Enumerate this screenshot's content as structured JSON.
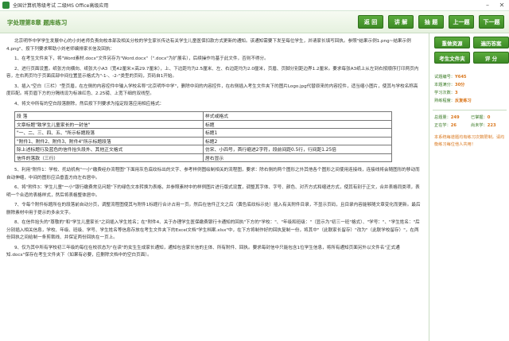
{
  "window": {
    "title": "全国计算机等级考试 二级MS Office高级应用",
    "minimize_icon": "minimize-icon",
    "close_icon": "close-icon"
  },
  "header": {
    "breadcrumb": "字处理第8章 题库练习",
    "nav_buttons": [
      "返 回",
      "讲 解",
      "抽 题",
      "上一题",
      "下一题"
    ]
  },
  "question": {
    "paragraphs_before_table": [
      "北京明华中学学生发展中心的小刘老师负责向校本部及相关分校的学生家长传达有关学生儿童医保扣款方式更新的通知。该通知需要下发至每位学生，并请家长填写回执。参照\"结果示例1.png~结果示例4.png\"、按下列要求帮助小刘老师编排家长信及回执：",
      "1、在考生文件夹下，将\"Word素材.docx\"文件另存为\"Word.docx\"（\".docx\"为扩展名），后续操作均基于此文件，否则不得分。",
      "2、进行页面设置。纸张方向横向、纸张大小A3（宽42厘米×高29.7厘米），上、下边距均为2.5厘米、左、右边距均为2.0厘米，页眉、页脚分别距边界1.2厘米。要求每张A3纸上从左到右按顺序打印两页内容，左右两页均于页面底部中间位置显示格式为\"-1-、-2-\"类型的页码，页码自1开始。",
      "3、插入\"空白（三栏）\"型页眉，在左侧的内容控件中输入学校名称\"北京明华中学\"，删除中间的内容控件，在右侧插入考生文件夹下的图片Logo.jpg代替原来的内容控件，适当缩小图片，使其与学校名称高度匹配。将页眉下方的分隔线设为标准红色、2.25磅、上宽下细的双线型。",
      "4、将文中所有的空白段落删除，然后按下列要求为指定段落应用相应格式："
    ],
    "table": {
      "header": [
        "段 落",
        "样式或格式"
      ],
      "rows": [
        [
          "文章标题\"致学生儿童家长的一封信\"",
          "标题"
        ],
        [
          "\"一、二、三、四、五、\"所示标题段落",
          "标题1"
        ],
        [
          "\"附件1、附件2、附件3、附件4\"所示标题段落",
          "标题2"
        ],
        [
          "除上述标题行及蓝色的信件抬头段外、其他正文格式",
          "仿宋、小四号，首行缩进2字符，段前间距0.5行，行间距1.25倍"
        ],
        [
          "信件的落款（三行）",
          "居右显示"
        ]
      ]
    },
    "paragraphs_after_table": [
      "5、利用\"附件1：学校、托幼机构\"一小\"缴费经办流程图\"下面用灰色底纹标出的文字、参考样例图绘制相关的流程图，要求：除右侧的两个图形之外其他各个图形之间使用连接线，连接线将会随图形的移动而自动伸缩，中间的图形应沿垂直方向左右居中。",
      "6、将\"附件3：学生儿童\"一小\"银行缴费常见问题\"下的绿色文本转换为表格，并参照素材中的样例图片进行版式设置，调整其字体、字号、颜色、对齐方式和缩进方式，使其有别于正文，合并表格同类项，表明一个合适的表格样式，然后将表格整体居中。",
      "7、令每个附件标题所在的段落前自动分页，调整流程图使其与附件1标题行合计占用一页。然后在信件正文之后（黄色底纹标示处）插入有关附件目录，不显示页码，且目录内容能够随文章变化而更新。最后删除素材中用于提示的多余文字。",
      "8、在信件抬头的\"尊敬的\"和\"学生儿童家长\"之间插入学生姓名；在\"附件4、关于办理学生医保缴费银行卡通知的回执\"下方的\"学校：\"、\"年级和班级：\"（显示为\"初三一班\"格式）、\"学号：\"、\"学生姓名：\"后分别插入相关信息，学校、年级、班级、学号、学生姓名等信息存放在考生文件夹下的Excel文档\"学生档案.xlsx\"中，在下方将制作好的回执复制一份，将其中\"（此联家长留存）\"改为\"（此联学校留存）\"，在两份回执之间给制一条剪裁线、并保证两份回执在一页上。",
      "9、仅为其中所有学校初三年级的每位在校状态为\"在读\"的女生生成家长通知，通知包含家长信的主体、所有附件、回执。要求每封信中只能包含1位学生信息，将所有通知页面另外以文件名\"正式通知.docx\"保存在考生文件夹下（如果有必要，应删除文档中的空白页面）。"
    ]
  },
  "sidebar": {
    "buttons": [
      "重做资源",
      "遍历答案",
      "考生文件夹",
      "评 分"
    ],
    "info": [
      {
        "label": "试题编号：",
        "value": "Y645"
      },
      {
        "label": "本题满分：",
        "value": "30分"
      },
      {
        "label": "学习次数：",
        "value": "3"
      },
      {
        "label": "熟练程度：",
        "value": "反复练习"
      }
    ],
    "stats": [
      {
        "label": "总题量：",
        "value": "249"
      },
      {
        "label": "已掌握：",
        "value": "0"
      },
      {
        "label": "正在学：",
        "value": "26"
      },
      {
        "label": "尚未学：",
        "value": "223"
      }
    ],
    "note": "本系统每道题均有练习次数限制，请均衡练习每位他人共用！"
  }
}
